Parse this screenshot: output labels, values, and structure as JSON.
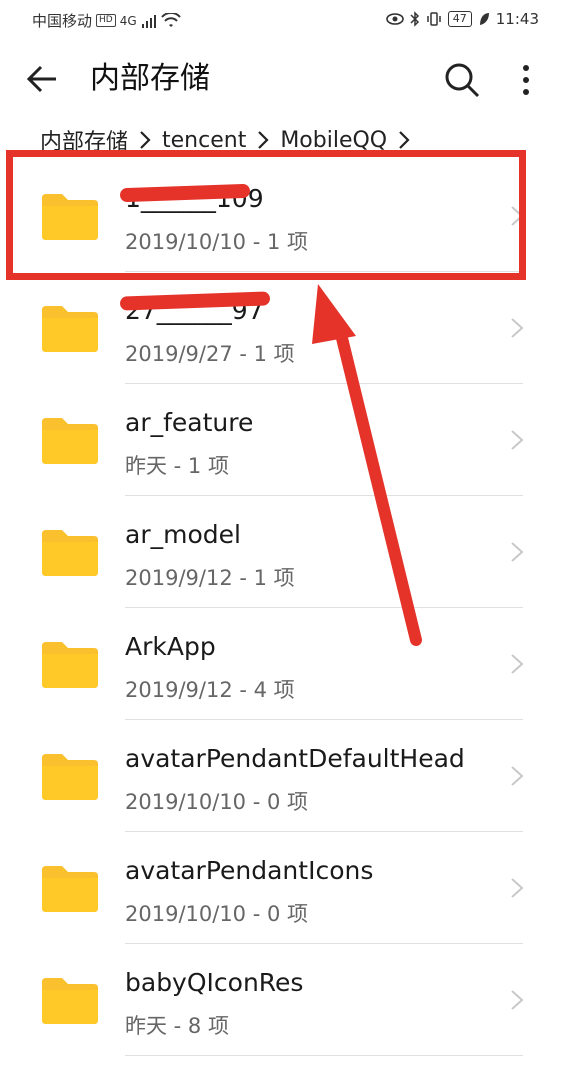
{
  "status_bar": {
    "carrier": "中国移动",
    "hd_badge": "HD",
    "network": "4G",
    "battery": "47",
    "time": "11:43"
  },
  "app_bar": {
    "title": "内部存储"
  },
  "breadcrumb": [
    "内部存储",
    "tencent",
    "MobileQQ"
  ],
  "folders": [
    {
      "name": "1______109",
      "meta": "2019/10/10 - 1 项",
      "redacted": true
    },
    {
      "name": "27______97",
      "meta": "2019/9/27 - 1 项",
      "redacted": true
    },
    {
      "name": "ar_feature",
      "meta": "昨天 - 1 项"
    },
    {
      "name": "ar_model",
      "meta": "2019/9/12 - 1 项"
    },
    {
      "name": "ArkApp",
      "meta": "2019/9/12 - 4 项"
    },
    {
      "name": "avatarPendantDefaultHead",
      "meta": "2019/10/10 - 0 项"
    },
    {
      "name": "avatarPendantIcons",
      "meta": "2019/10/10 - 0 项"
    },
    {
      "name": "babyQIconRes",
      "meta": "昨天 - 8 项"
    }
  ],
  "colors": {
    "folder": "#FBC02D",
    "annotation": "#E5332A"
  },
  "icons": {
    "back": "arrow-left-icon",
    "search": "search-icon",
    "more": "more-vertical-icon",
    "folder": "folder-icon",
    "chevron": "chevron-right-icon"
  }
}
